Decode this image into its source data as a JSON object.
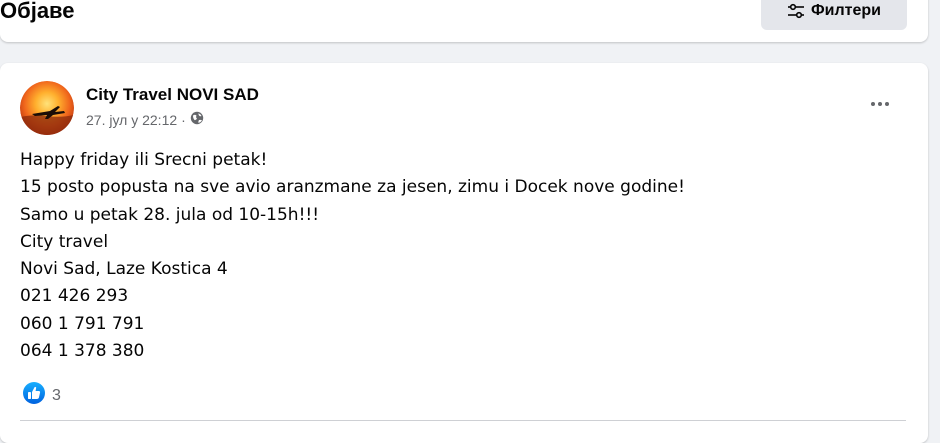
{
  "header": {
    "title": "Објаве",
    "filter_button_label": "Филтери",
    "filter_icon": "sliders-icon"
  },
  "post": {
    "author": "City Travel NOVI SAD",
    "date": "27. јул у 22:12",
    "meta_separator": "·",
    "audience_icon": "globe-icon",
    "more_icon": "more-dots-icon",
    "body_lines": [
      "Happy friday ili Srecni petak!",
      "15 posto popusta na sve avio aranzmane za jesen, zimu i Docek nove godine!",
      "Samo u petak 28. jula od 10-15h!!!",
      "City travel",
      "Novi Sad, Laze Kostica 4",
      "021 426 293",
      "060 1 791 791",
      "064 1 378 380"
    ],
    "reaction_icon": "like-icon",
    "reaction_count": "3"
  },
  "colors": {
    "background": "#f0f2f5",
    "card": "#ffffff",
    "secondary_text": "#65676b",
    "like_blue": "#1877f2",
    "button_gray": "#e4e6eb"
  }
}
